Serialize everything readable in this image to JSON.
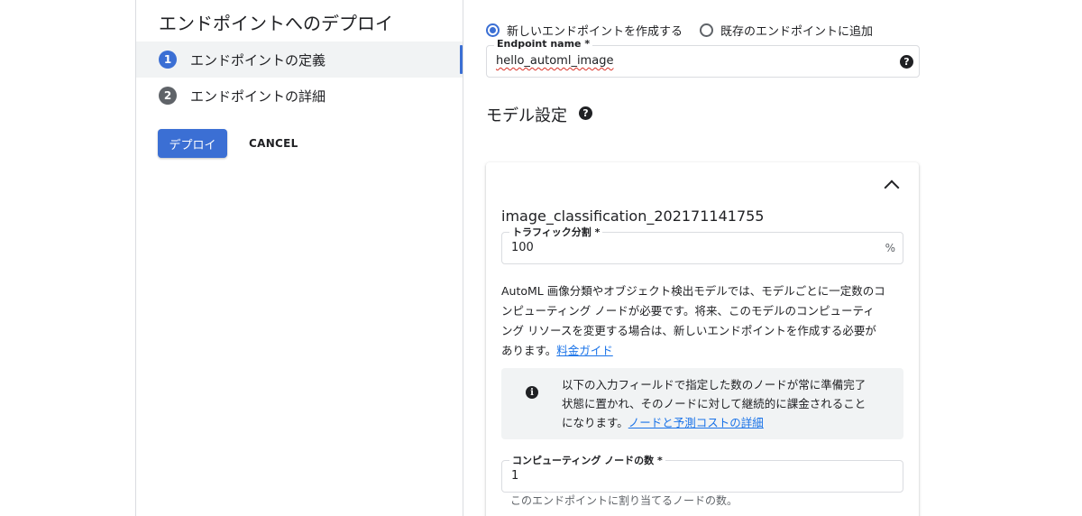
{
  "page_title": "エンドポイントへのデプロイ",
  "steps": [
    {
      "number": "1",
      "label": "エンドポイントの定義",
      "active": true
    },
    {
      "number": "2",
      "label": "エンドポイントの詳細",
      "active": false
    }
  ],
  "actions": {
    "deploy_label": "デプロイ",
    "cancel_label": "CANCEL"
  },
  "endpoint": {
    "options": [
      {
        "label": "新しいエンドポイントを作成する",
        "selected": true
      },
      {
        "label": "既存のエンドポイントに追加",
        "selected": false
      }
    ],
    "name_label": "Endpoint name *",
    "name_value": "hello_automl_image"
  },
  "model_settings": {
    "title": "モデル設定",
    "model_name": "image_classification_202171141755",
    "traffic_label": "トラフィック分割 *",
    "traffic_value": "100",
    "traffic_suffix": "%",
    "description_lines": [
      "AutoML 画像分類やオブジェクト検出モデルでは、モデルごとに一定数のコ",
      "ンピューティング ノードが必要です。将来、このモデルのコンピューティ",
      "ング リソースを変更する場合は、新しいエンドポイントを作成する必要が"
    ],
    "description_last": "あります。",
    "pricing_link": "料金ガイド",
    "info_lines": [
      "以下の入力フィールドで指定した数のノードが常に準備完了",
      "状態に置かれ、そのノードに対して継続的に課金されること"
    ],
    "info_last": "になります。",
    "info_link": "ノードと予測コストの詳細",
    "compute_label": "コンピューティング ノードの数 *",
    "compute_value": "1",
    "compute_hint": "このエンドポイントに割り当てるノードの数。"
  },
  "icons": {
    "help": "?",
    "info": "i"
  },
  "colors": {
    "accent": "#3b6fd4",
    "link": "#1a73e8"
  }
}
